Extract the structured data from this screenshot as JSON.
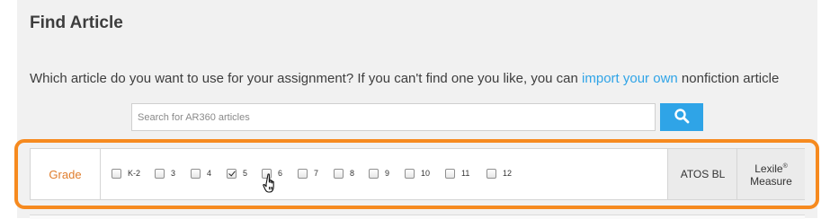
{
  "title": "Find Article",
  "description": {
    "before": "Which article do you want to use for your assignment? If you can't find one you like, you can ",
    "link": "import your own",
    "after": " nonfiction article"
  },
  "search": {
    "placeholder": "Search for AR360 articles",
    "value": ""
  },
  "filters": {
    "grade_label": "Grade",
    "grades": [
      {
        "label": "K-2",
        "checked": false
      },
      {
        "label": "3",
        "checked": false
      },
      {
        "label": "4",
        "checked": false
      },
      {
        "label": "5",
        "checked": true
      },
      {
        "label": "6",
        "checked": false
      },
      {
        "label": "7",
        "checked": false
      },
      {
        "label": "8",
        "checked": false
      },
      {
        "label": "9",
        "checked": false
      },
      {
        "label": "10",
        "checked": false
      },
      {
        "label": "11",
        "checked": false
      },
      {
        "label": "12",
        "checked": false
      }
    ],
    "atos_label": "ATOS BL",
    "lexile_label": "Lexile",
    "lexile_mark": "®",
    "measure_label": "Measure"
  },
  "colors": {
    "accent": "#2fa4e7",
    "highlight": "#f68a1f",
    "grade_label": "#e07d2c"
  },
  "icons": {
    "search": "search-icon",
    "cursor": "hand-pointer-icon"
  }
}
